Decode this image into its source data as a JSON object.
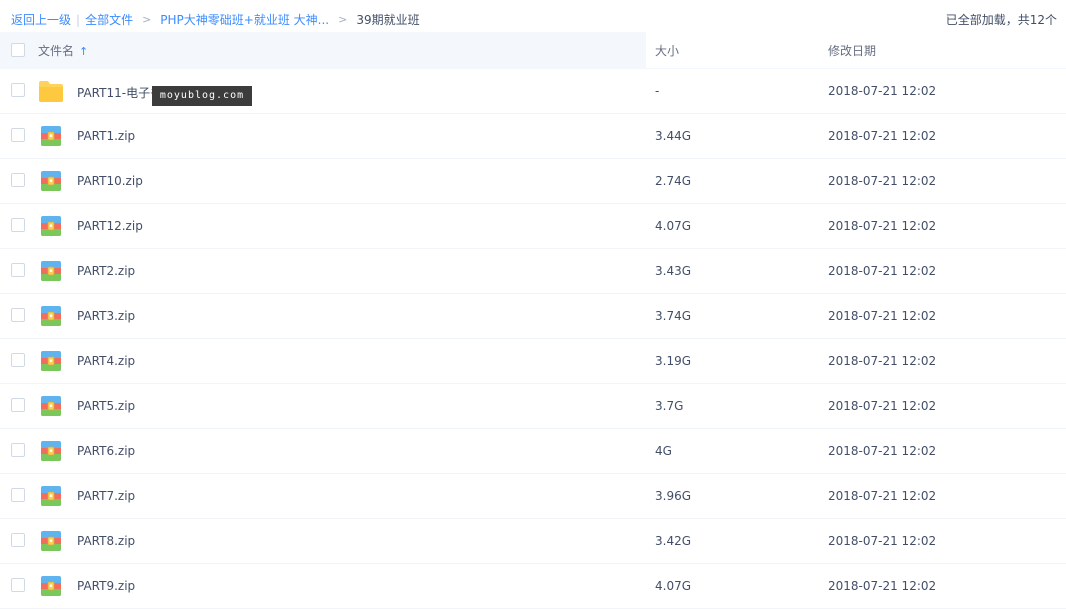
{
  "breadcrumb": {
    "back_label": "返回上一级",
    "separator": "|",
    "all_files_label": "全部文件",
    "arrow": ">",
    "parent_folder_label": "PHP大神零础班+就业班 大神...",
    "current_folder_label": "39期就业班"
  },
  "status": {
    "load_text": "已全部加载，共12个"
  },
  "table": {
    "header": {
      "name": "文件名",
      "sort_icon": "↑",
      "size": "大小",
      "date": "修改日期"
    },
    "rows": [
      {
        "name": "PART11-电子书",
        "size": "-",
        "date": "2018-07-21 12:02",
        "type": "folder"
      },
      {
        "name": "PART1.zip",
        "size": "3.44G",
        "date": "2018-07-21 12:02",
        "type": "zip"
      },
      {
        "name": "PART10.zip",
        "size": "2.74G",
        "date": "2018-07-21 12:02",
        "type": "zip"
      },
      {
        "name": "PART12.zip",
        "size": "4.07G",
        "date": "2018-07-21 12:02",
        "type": "zip"
      },
      {
        "name": "PART2.zip",
        "size": "3.43G",
        "date": "2018-07-21 12:02",
        "type": "zip"
      },
      {
        "name": "PART3.zip",
        "size": "3.74G",
        "date": "2018-07-21 12:02",
        "type": "zip"
      },
      {
        "name": "PART4.zip",
        "size": "3.19G",
        "date": "2018-07-21 12:02",
        "type": "zip"
      },
      {
        "name": "PART5.zip",
        "size": "3.7G",
        "date": "2018-07-21 12:02",
        "type": "zip"
      },
      {
        "name": "PART6.zip",
        "size": "4G",
        "date": "2018-07-21 12:02",
        "type": "zip"
      },
      {
        "name": "PART7.zip",
        "size": "3.96G",
        "date": "2018-07-21 12:02",
        "type": "zip"
      },
      {
        "name": "PART8.zip",
        "size": "3.42G",
        "date": "2018-07-21 12:02",
        "type": "zip"
      },
      {
        "name": "PART9.zip",
        "size": "4.07G",
        "date": "2018-07-21 12:02",
        "type": "zip"
      }
    ]
  },
  "watermark": {
    "text": "moyublog.com"
  },
  "icons": {
    "folder": "folder-icon",
    "zip": "zip-archive-icon"
  },
  "colors": {
    "link": "#3b8cff",
    "text": "#424e67",
    "header_bg": "#f4f8fd",
    "folder_yellow": "#ffd25a"
  }
}
